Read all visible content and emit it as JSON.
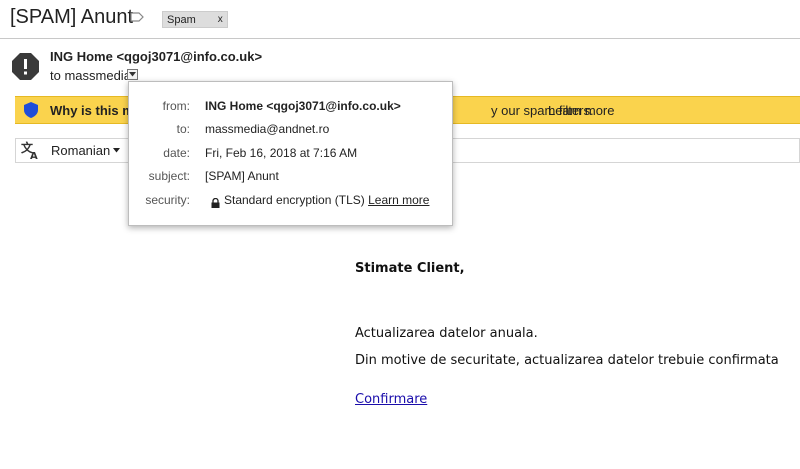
{
  "header": {
    "subject": "[SPAM] Anunt",
    "spam_chip_label": "Spam",
    "spam_chip_close": "x"
  },
  "sender": {
    "line": "ING Home <qgoj3071@info.co.uk>",
    "to_line": "to massmedia"
  },
  "banner": {
    "question": "Why is this me",
    "tail": "y our spam filters.",
    "learn_more": "Learn more"
  },
  "translate": {
    "language": "Romanian"
  },
  "details": {
    "from_label": "from:",
    "from_value": "ING Home <qgoj3071@info.co.uk>",
    "to_label": "to:",
    "to_value": "massmedia@andnet.ro",
    "date_label": "date:",
    "date_value": "Fri, Feb 16, 2018 at 7:16 AM",
    "subject_label": "subject:",
    "subject_value": "[SPAM] Anunt",
    "security_label": "security:",
    "security_value": "Standard encryption (TLS)",
    "security_link": "Learn more"
  },
  "message": {
    "greeting": "Stimate Client,",
    "line1": "Actualizarea datelor anuala.",
    "line2": "Din motive de securitate, actualizarea datelor trebuie confirmata",
    "link": "Confirmare"
  },
  "colors": {
    "banner": "#fad34d",
    "link": "#1a0dab",
    "shield": "#1f4ed8",
    "avatar": "#3a3a3a"
  },
  "icons": [
    "label-tag-icon",
    "warning-octagon-icon",
    "chevron-down-icon",
    "shield-icon",
    "translate-icon",
    "lock-icon"
  ]
}
